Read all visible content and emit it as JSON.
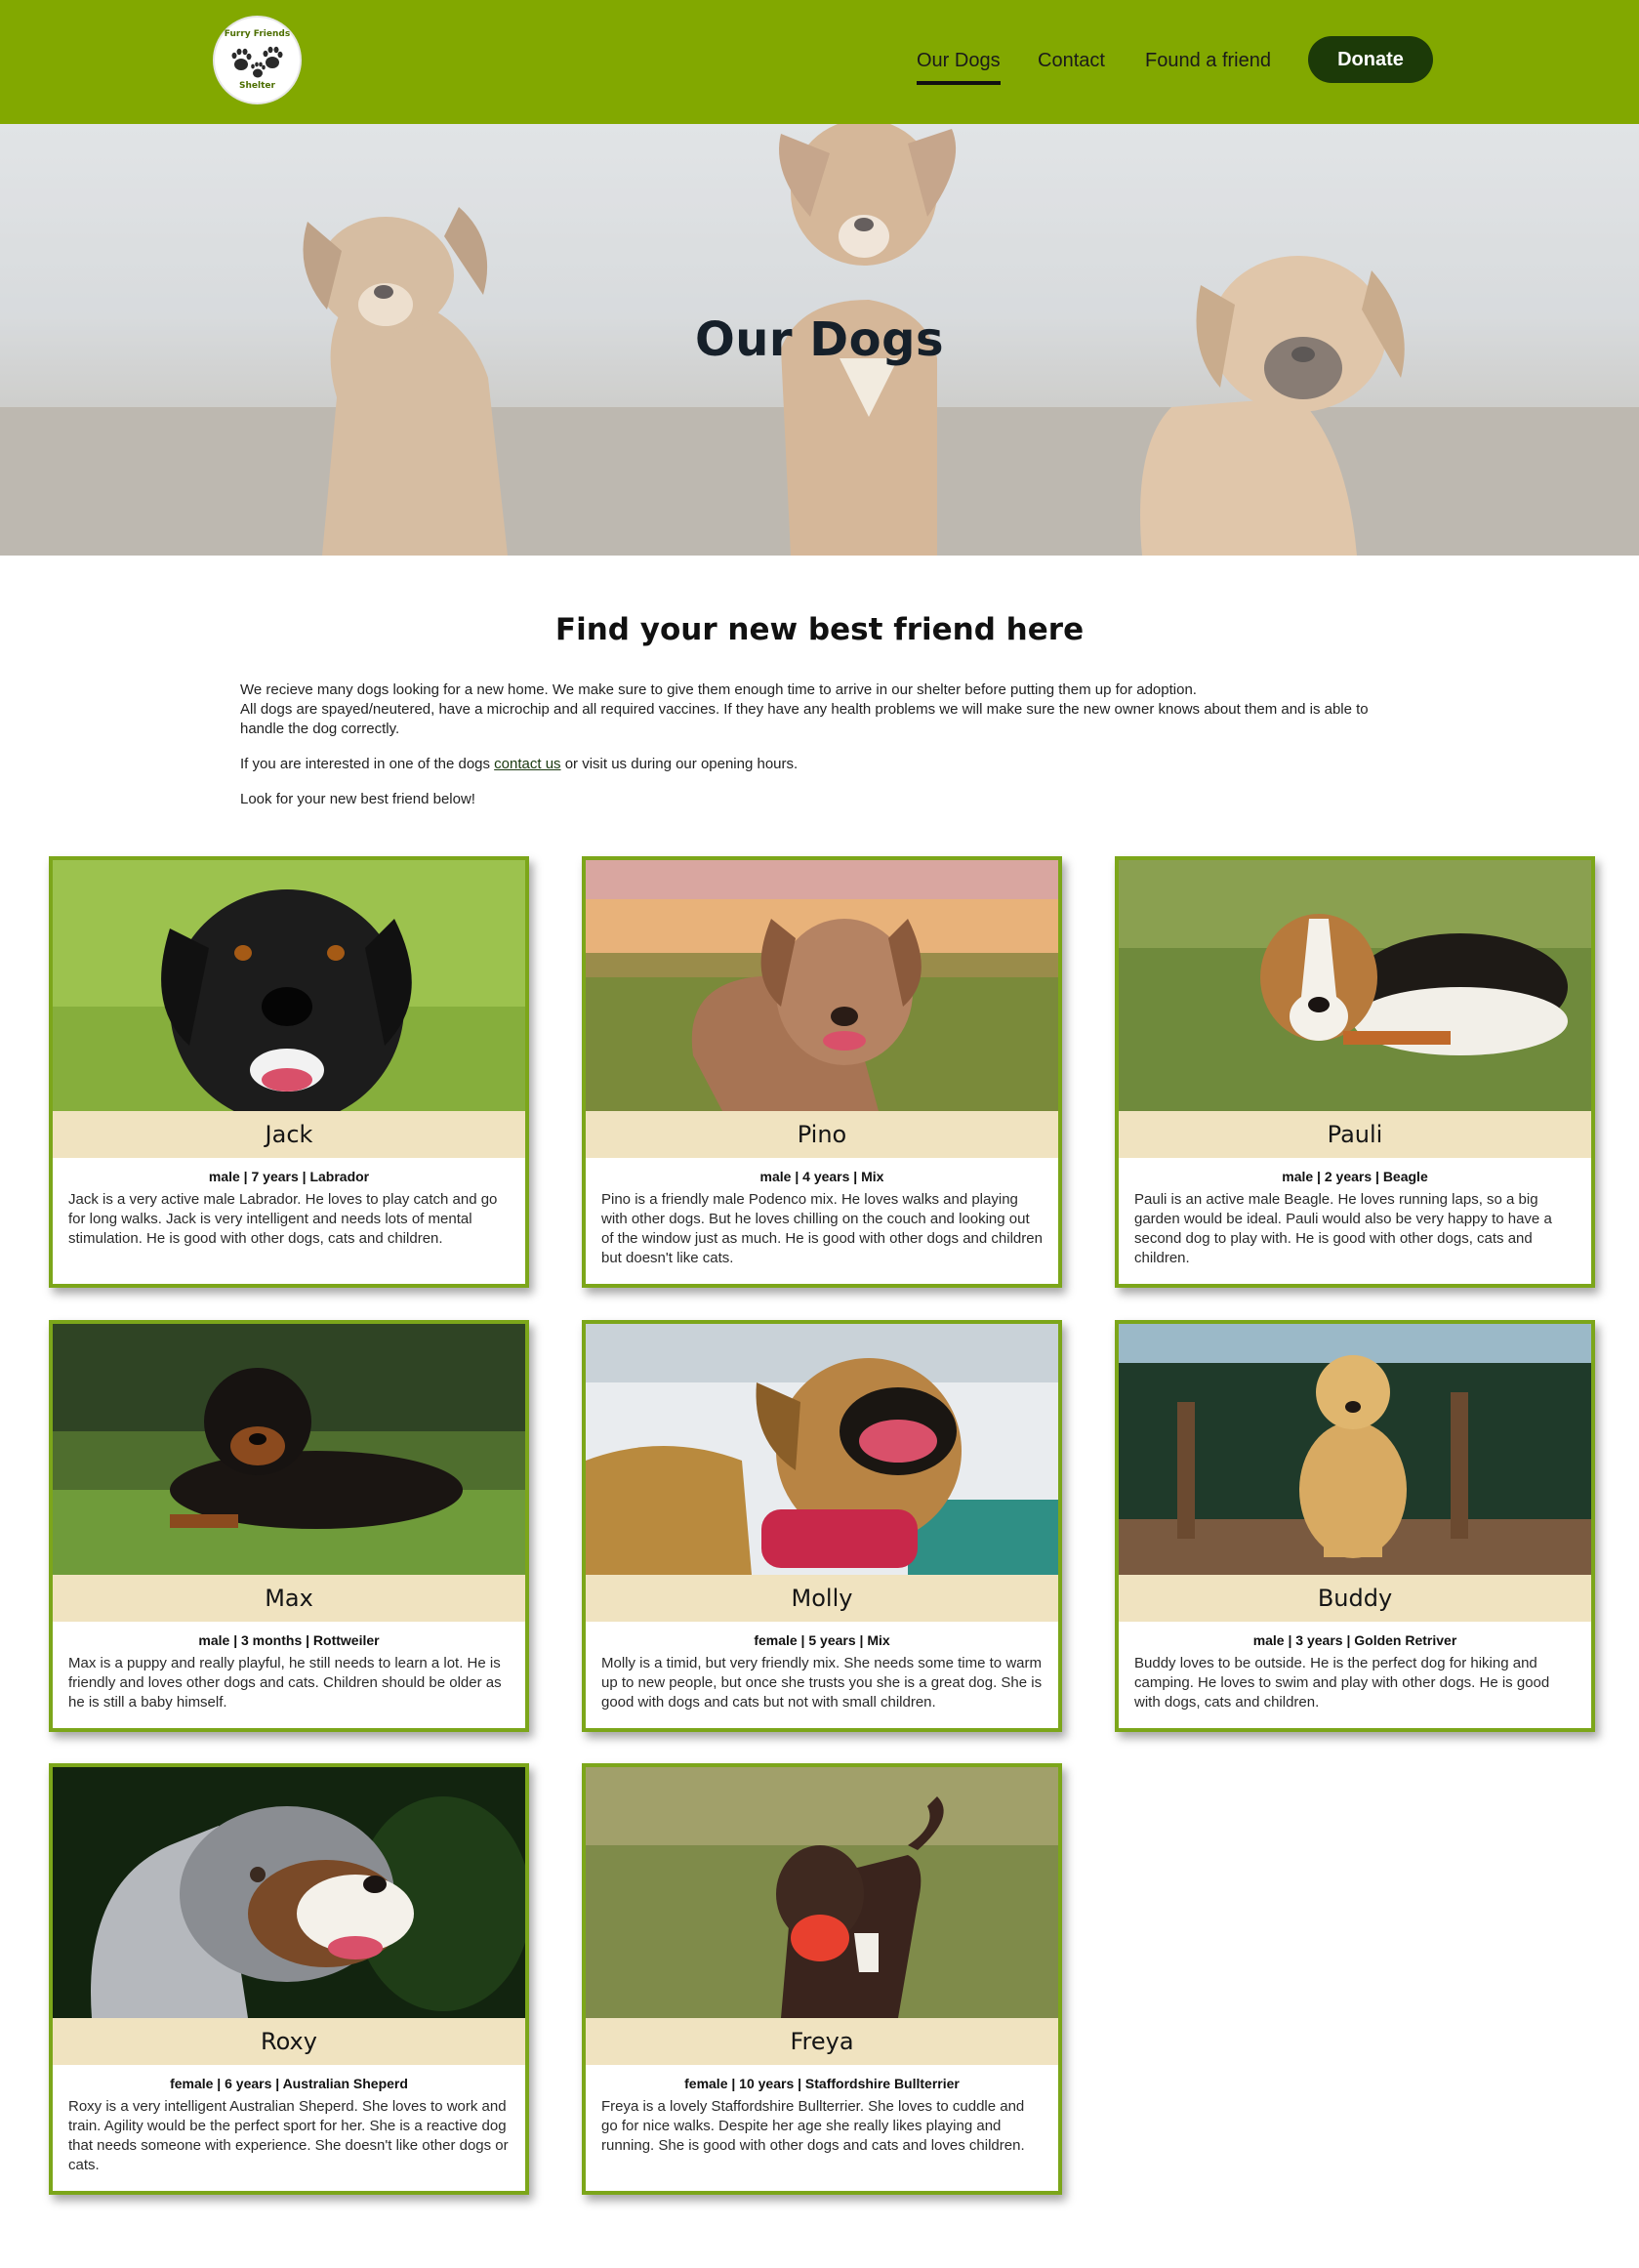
{
  "logo": {
    "top_text": "Furry Friends",
    "bottom_text": "Shelter"
  },
  "nav": {
    "items": [
      {
        "label": "Our Dogs",
        "active": true
      },
      {
        "label": "Contact",
        "active": false
      },
      {
        "label": "Found a friend",
        "active": false
      }
    ],
    "donate_label": "Donate"
  },
  "hero": {
    "title": "Our Dogs"
  },
  "intro": {
    "title": "Find your new best friend here",
    "paragraph1_line1": "We recieve many dogs looking for a new home. We make sure to give them enough time to arrive in our shelter before putting them up for adoption.",
    "paragraph1_line2": "All dogs are spayed/neutered, have a microchip and all required vaccines. If they have any health problems we will make sure the new owner knows about them and is able to handle the dog correctly.",
    "paragraph2_before": "If you are interested in one of the dogs ",
    "paragraph2_link": "contact us",
    "paragraph2_after": " or visit us during our opening hours.",
    "paragraph3": "Look for your new best friend below!"
  },
  "dogs": [
    {
      "name": "Jack",
      "meta": "male | 7 years | Labrador",
      "description": "Jack is a very active male Labrador. He loves to play catch and go for long walks. Jack is very intelligent and needs lots of mental stimulation. He is good with other dogs, cats and children."
    },
    {
      "name": "Pino",
      "meta": "male | 4 years | Mix",
      "description": "Pino is a friendly male Podenco mix. He loves walks and playing with other dogs. But he loves chilling on the couch and looking out of the window just as much. He is good with other dogs and children but doesn't like cats."
    },
    {
      "name": "Pauli",
      "meta": "male | 2 years | Beagle",
      "description": "Pauli is an active male Beagle. He loves running laps, so a big garden would be ideal. Pauli would also be very happy to have a second dog to play with. He is good with other dogs, cats and children."
    },
    {
      "name": "Max",
      "meta": "male | 3 months | Rottweiler",
      "description": "Max is a puppy and really playful, he still needs to learn a lot. He is friendly and loves other dogs and cats. Children should be older as he is still a baby himself."
    },
    {
      "name": "Molly",
      "meta": "female | 5 years | Mix",
      "description": "Molly is a timid, but very friendly mix. She needs some time to warm up to new people, but once she trusts you she is a great dog. She is good with dogs and cats but not with small children."
    },
    {
      "name": "Buddy",
      "meta": "male | 3 years | Golden Retriver",
      "description": "Buddy loves to be outside. He is the perfect dog for hiking and camping. He loves to swim and play with other dogs. He is good with dogs, cats and children."
    },
    {
      "name": "Roxy",
      "meta": "female | 6 years | Australian Sheperd",
      "description": "Roxy is a very intelligent Australian Sheperd. She loves to work and train. Agility would be the perfect sport for her. She is a reactive dog that needs someone with experience. She doesn't like other dogs or cats."
    },
    {
      "name": "Freya",
      "meta": "female | 10 years | Staffordshire Bullterrier",
      "description": "Freya is a lovely Staffordshire Bullterrier. She loves to cuddle and go for nice walks. Despite her age she really likes playing and running. She is good with other dogs and cats and loves children."
    }
  ],
  "colors": {
    "header": "#82a800",
    "donate": "#1c3a08",
    "card_border": "#7ca61a",
    "name_bar": "#f0e3c0"
  }
}
